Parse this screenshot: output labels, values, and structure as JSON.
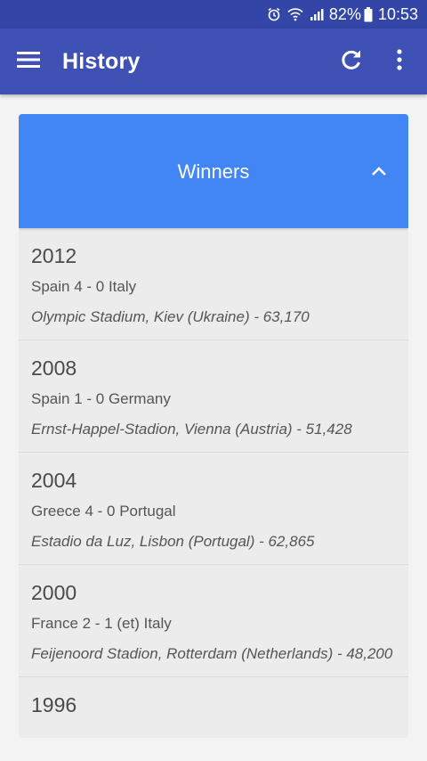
{
  "status_bar": {
    "battery": "82%",
    "time": "10:53",
    "icons": [
      "alarm-icon",
      "wifi-icon",
      "signal-icon",
      "battery-icon"
    ]
  },
  "app_bar": {
    "title": "History",
    "icons": [
      "menu-icon",
      "refresh-icon",
      "overflow-menu-icon"
    ]
  },
  "panel": {
    "title": "Winners",
    "icon": "chevron-up-icon",
    "color": "#4285f4"
  },
  "winners": [
    {
      "year": "2012",
      "result": "Spain 4 - 0 Italy",
      "venue": "Olympic Stadium, Kiev (Ukraine) - 63,170"
    },
    {
      "year": "2008",
      "result": "Spain 1 - 0 Germany",
      "venue": "Ernst-Happel-Stadion, Vienna (Austria) - 51,428"
    },
    {
      "year": "2004",
      "result": "Greece 4 - 0 Portugal",
      "venue": "Estadio da Luz, Lisbon (Portugal) - 62,865"
    },
    {
      "year": "2000",
      "result": "France 2 - 1 (et) Italy",
      "venue": "Feijenoord Stadion, Rotterdam (Netherlands) - 48,200"
    },
    {
      "year": "1996",
      "result": "",
      "venue": ""
    }
  ],
  "colors": {
    "status_bar": "#3346a8",
    "app_bar": "#3f51b5",
    "background": "#f3f3f3"
  }
}
